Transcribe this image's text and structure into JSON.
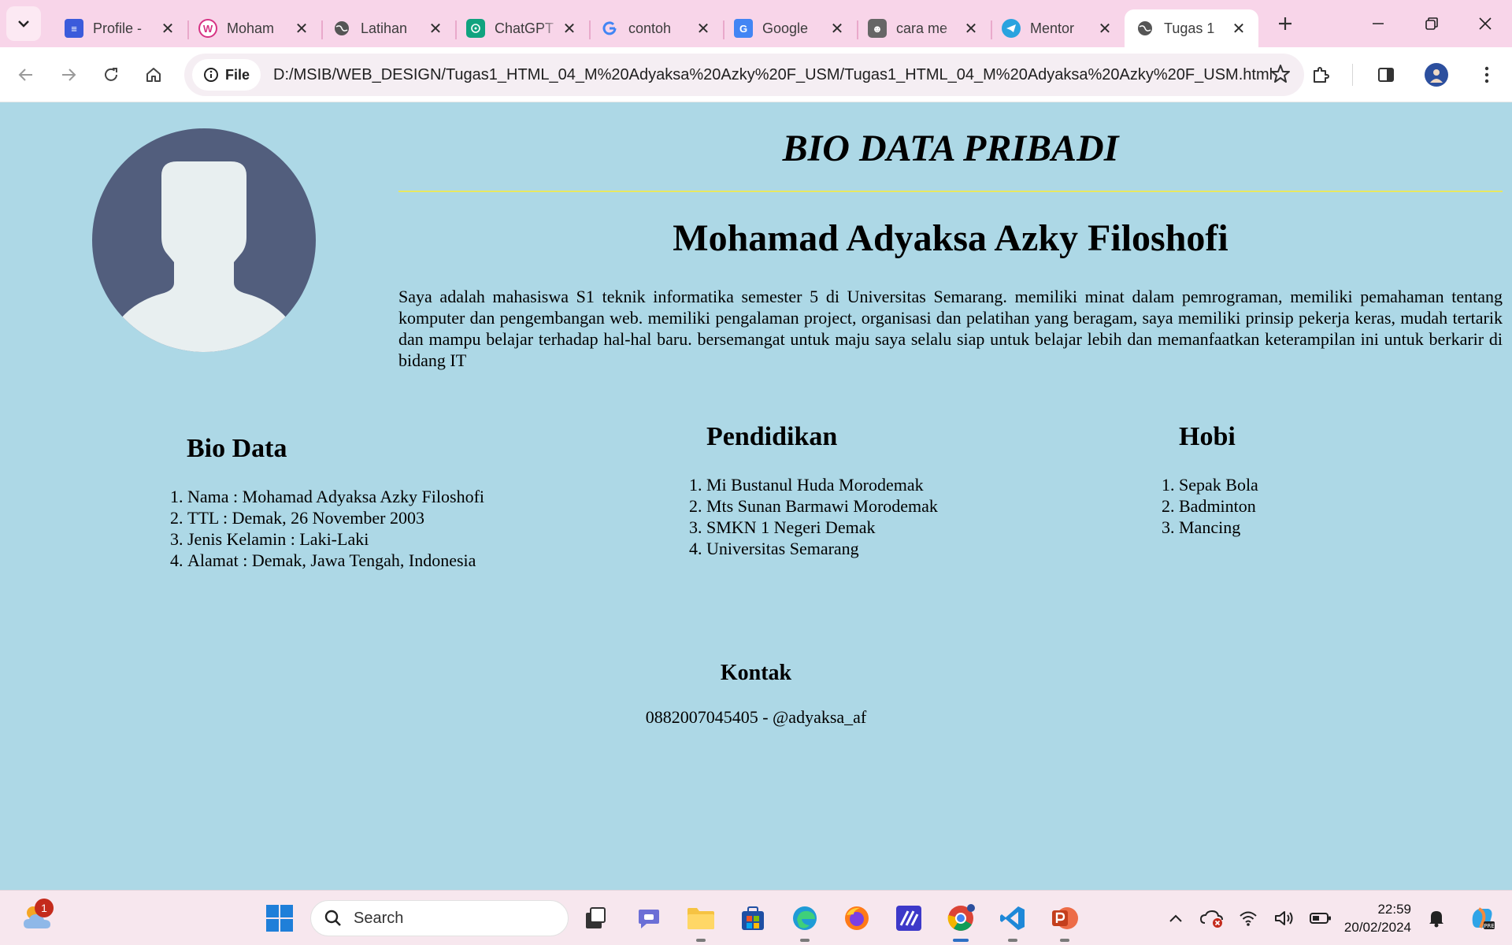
{
  "browser": {
    "tabs": [
      {
        "title": "Profile -",
        "icon": "site-favicon",
        "color": "#3b5bdb"
      },
      {
        "title": "Moham",
        "icon": "wordpress-favicon",
        "color": "#d63384"
      },
      {
        "title": "Latihan",
        "icon": "globe-favicon",
        "color": "#555555"
      },
      {
        "title": "ChatGPT",
        "icon": "chatgpt-favicon",
        "color": "#10a37f"
      },
      {
        "title": "contoh",
        "icon": "google-favicon",
        "color": "#4285f4"
      },
      {
        "title": "Google",
        "icon": "google-translate-favicon",
        "color": "#4285f4"
      },
      {
        "title": "cara me",
        "icon": "hacker-favicon",
        "color": "#444444"
      },
      {
        "title": "Mentor",
        "icon": "telegram-favicon",
        "color": "#2aa3df"
      },
      {
        "title": "Tugas 1",
        "icon": "globe-favicon",
        "color": "#555555",
        "active": true
      }
    ],
    "address": {
      "scheme_label": "File",
      "url": "D:/MSIB/WEB_DESIGN/Tugas1_HTML_04_M%20Adyaksa%20Azky%20F_USM/Tugas1_HTML_04_M%20Adyaksa%20Azky%20F_USM.html"
    }
  },
  "page": {
    "title": "BIO DATA PRIBADI",
    "name": "Mohamad Adyaksa Azky Filoshofi",
    "intro": "Saya adalah mahasiswa S1 teknik informatika semester 5 di Universitas Semarang. memiliki minat dalam pemrograman, memiliki pemahaman tentang komputer dan pengembangan web. memiliki pengalaman project, organisasi dan pelatihan yang beragam, saya memiliki prinsip pekerja keras, mudah tertarik dan mampu belajar terhadap hal-hal baru. bersemangat untuk maju saya selalu siap untuk belajar lebih dan memanfaatkan keterampilan ini untuk berkarir di bidang IT",
    "sections": {
      "bio": {
        "heading": "Bio Data",
        "items": [
          "Nama : Mohamad Adyaksa Azky Filoshofi",
          "TTL : Demak, 26 November 2003",
          "Jenis Kelamin : Laki-Laki",
          "Alamat : Demak, Jawa Tengah, Indonesia"
        ]
      },
      "education": {
        "heading": "Pendidikan",
        "items": [
          "Mi Bustanul Huda Morodemak",
          "Mts Sunan Barmawi Morodemak",
          "SMKN 1 Negeri Demak",
          "Universitas Semarang"
        ]
      },
      "hobbies": {
        "heading": "Hobi",
        "items": [
          "Sepak Bola",
          "Badminton",
          "Mancing"
        ]
      }
    },
    "contact": {
      "heading": "Kontak",
      "text": "0882007045405 - @adyaksa_af"
    }
  },
  "taskbar": {
    "weather_badge": "1",
    "search_placeholder": "Search",
    "time": "22:59",
    "date": "20/02/2024"
  },
  "colors": {
    "page_background": "#add8e6",
    "title_rule": "#e8e860",
    "tabstrip": "#f8d5e9",
    "avatar_bg": "#525e7d"
  }
}
